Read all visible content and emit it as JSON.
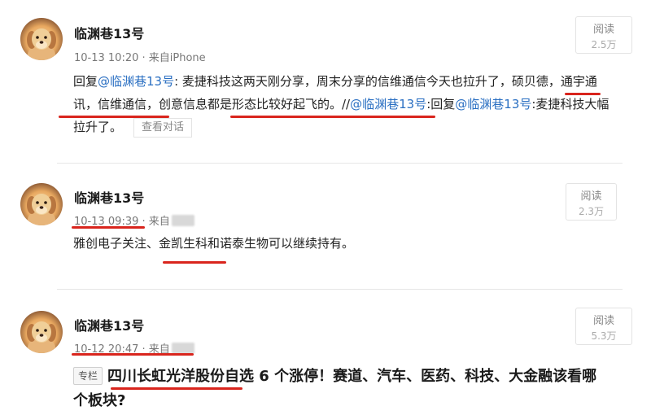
{
  "posts": [
    {
      "author": "临渊巷13号",
      "time": "10-13 10:20",
      "source_prefix": "· 来自",
      "source": "iPhone",
      "read_label": "阅读",
      "read_count": "2.5万",
      "reply_prefix": "回复",
      "reply_mention": "@临渊巷13号",
      "body_1": ": 麦捷科技这两天刚分享，周末分享的信维通信今天也拉升了，硕贝德，通宇通讯，信维通信，创意信息都是形态比较好起飞的。//",
      "body_mention_2": "@临渊巷13号",
      "body_2": ":回复",
      "body_mention_3": "@临渊巷13号",
      "body_3": ":麦捷科技大幅拉升了。",
      "dialog_button": "查看对话"
    },
    {
      "author": "临渊巷13号",
      "time": "10-13 09:39",
      "source_prefix": "· 来自",
      "read_label": "阅读",
      "read_count": "2.3万",
      "body": "雅创电子关注、金凯生科和诺泰生物可以继续持有。"
    },
    {
      "author": "临渊巷13号",
      "time": "10-12 20:47",
      "source_prefix": "· 来自",
      "read_label": "阅读",
      "read_count": "5.3万",
      "tag": "专栏",
      "headline": "四川长虹光洋股份自选 6 个涨停！赛道、汽车、医药、科技、大金融该看哪个板块?"
    }
  ],
  "colors": {
    "link": "#2a6fc2",
    "annotation": "#d9251d"
  },
  "icons": {
    "avatar": "golden-retriever-puppy"
  }
}
